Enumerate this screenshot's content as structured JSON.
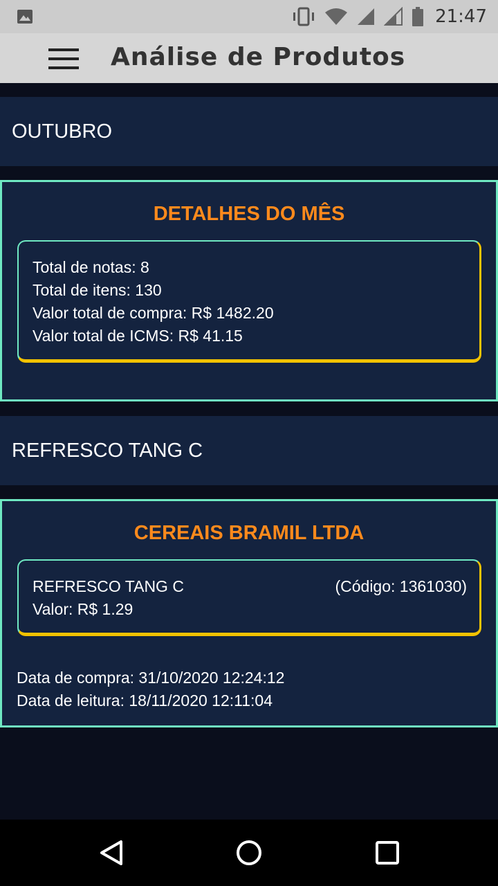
{
  "status_bar": {
    "time": "21:47",
    "left_icon": "image-icon",
    "right_icons": [
      "vibrate-icon",
      "wifi-icon",
      "signal-icon",
      "signal-icon",
      "battery-icon"
    ]
  },
  "app_bar": {
    "title": "Análise de Produtos",
    "menu_icon": "menu-icon"
  },
  "month": {
    "header": "OUTUBRO",
    "details": {
      "title": "DETALHES DO MÊS",
      "lines": [
        "Total de notas: 8",
        "Total de itens: 130",
        "Valor total de compra: R$ 1482.20",
        "Valor total de ICMS: R$ 41.15"
      ]
    }
  },
  "product": {
    "header": "REFRESCO TANG C",
    "card": {
      "title": "CEREAIS BRAMIL LTDA",
      "name": "REFRESCO TANG C",
      "code": "(Código: 1361030)",
      "value": "Valor: R$ 1.29",
      "purchase_date": "Data de compra: 31/10/2020 12:24:12",
      "read_date": "Data de leitura: 18/11/2020 12:11:04"
    }
  },
  "nav_bar": {
    "buttons": [
      "back-icon",
      "home-icon",
      "recents-icon"
    ]
  },
  "colors": {
    "appbar": "#d6d6d6",
    "background": "#0a0e1c",
    "panel": "#14233f",
    "card_border": "#6fe8c2",
    "inner_shadow": "#f2c200",
    "title_accent": "#ff8a1c"
  }
}
